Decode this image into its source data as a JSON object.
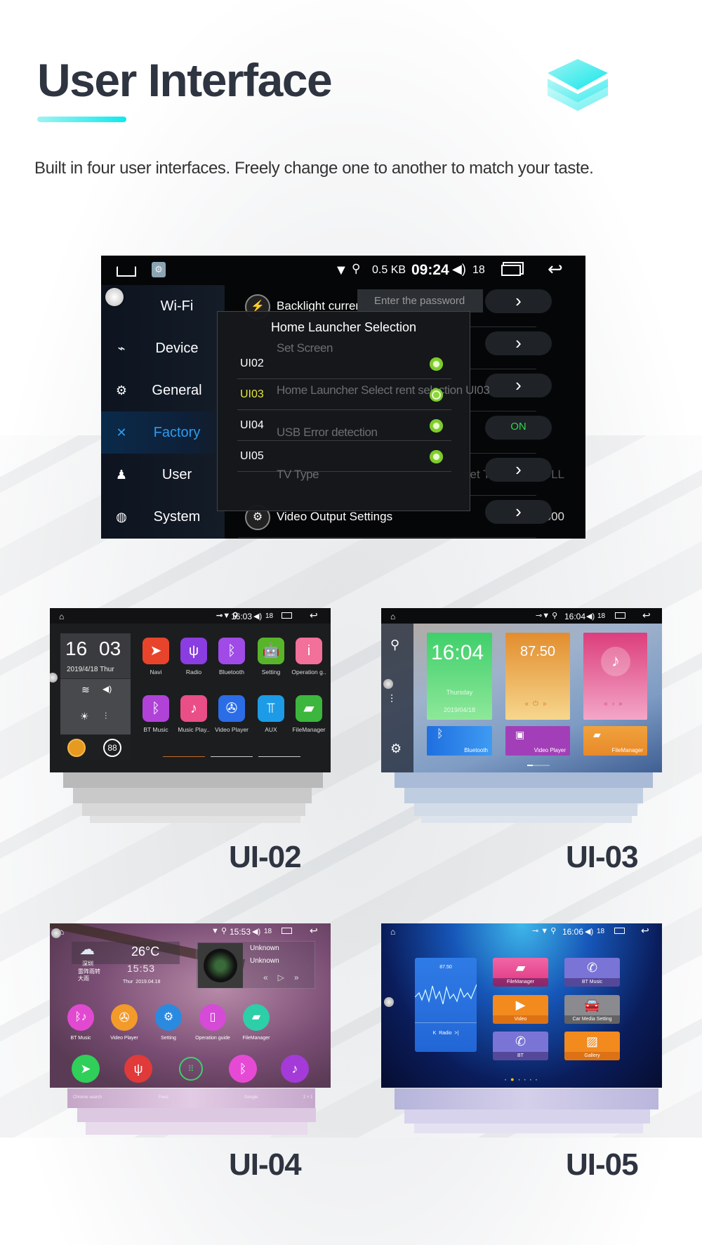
{
  "header": {
    "title": "User Interface",
    "subtitle": "Built in four user interfaces. Freely change one to another to match your taste.",
    "accent": "#0ee9ee",
    "title_color": "#2f3441",
    "icon": "layers-icon"
  },
  "settings_screen": {
    "status": {
      "data_rate": "0.5 KB",
      "time": "09:24",
      "volume": "18"
    },
    "sidebar": [
      {
        "label": "Wi-Fi",
        "icon": "wifi-icon"
      },
      {
        "label": "Device",
        "icon": "device-icon"
      },
      {
        "label": "General",
        "icon": "gear-icon"
      },
      {
        "label": "Factory",
        "icon": "wrench-icon",
        "active": true
      },
      {
        "label": "User",
        "icon": "user-icon"
      },
      {
        "label": "System",
        "icon": "globe-icon"
      }
    ],
    "rows": [
      {
        "label": "Backlight curren",
        "value": ""
      },
      {
        "label": "Set Screen",
        "value": ""
      },
      {
        "label": "Home Launcher Select rent selection UI03",
        "value": ""
      },
      {
        "label": "USB Error detection",
        "value": "ON"
      },
      {
        "label": "TV Type",
        "value": "set TV Type: NULL"
      },
      {
        "label": "Video Output Settings",
        "value": "1024x600"
      }
    ],
    "password_placeholder": "Enter the password",
    "toggle_on": "ON",
    "popup": {
      "title": "Home Launcher Selection",
      "options": [
        "UI02",
        "UI03",
        "UI04",
        "UI05"
      ],
      "selected": "UI03",
      "highlight_color": "#e6e63a"
    }
  },
  "ui02": {
    "label": "UI-02",
    "time": "16:03",
    "volume": "18",
    "clock_h": "16",
    "clock_m": "03",
    "date": "2019/4/18 Thur",
    "apps": [
      "Navi",
      "Radio",
      "Bluetooth",
      "Setting",
      "Operation g..",
      "BT Music",
      "Music Play..",
      "Video Player",
      "AUX",
      "FileManager"
    ]
  },
  "ui03": {
    "label": "UI-03",
    "time": "16:04",
    "volume": "18",
    "clock": "16:04",
    "day": "Thursday",
    "date": "2019/04/18",
    "radio": "87.50",
    "tiles": [
      "Bluetooth",
      "Video Player",
      "FileManager"
    ]
  },
  "ui04": {
    "label": "UI-04",
    "time": "15:53",
    "volume": "18",
    "temp": "26°C",
    "clock": "15:53",
    "day": "Thur",
    "date": "2019.04.18",
    "city": "深圳",
    "weather": "雷阵雨转大雨",
    "artist": "Unknown",
    "track": "Unknown",
    "apps": [
      "BT Music",
      "Video Player",
      "Setting",
      "Operation guide",
      "FileManager"
    ],
    "dock": [
      "Chrome search",
      "Feed",
      "Google",
      "2 × 1"
    ]
  },
  "ui05": {
    "label": "UI-05",
    "time": "16:06",
    "volume": "18",
    "radio_freq": "87.50",
    "radio_label": "Radio",
    "tiles": [
      "FileManager",
      "BT Music",
      "Video",
      "Car Media Setting",
      "BT",
      "Gallery"
    ]
  }
}
